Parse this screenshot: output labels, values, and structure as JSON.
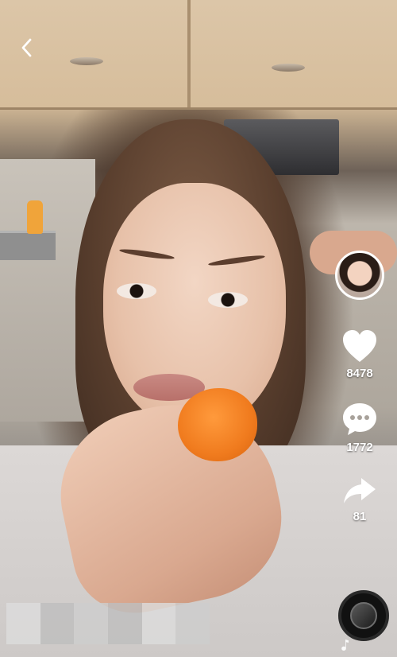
{
  "actions": {
    "like_count": "8478",
    "comment_count": "1772",
    "share_count": "81"
  },
  "icons": {
    "back": "back-icon",
    "avatar": "avatar",
    "like": "heart-icon",
    "comment": "comment-icon",
    "share": "share-icon",
    "music": "music-note-icon"
  }
}
